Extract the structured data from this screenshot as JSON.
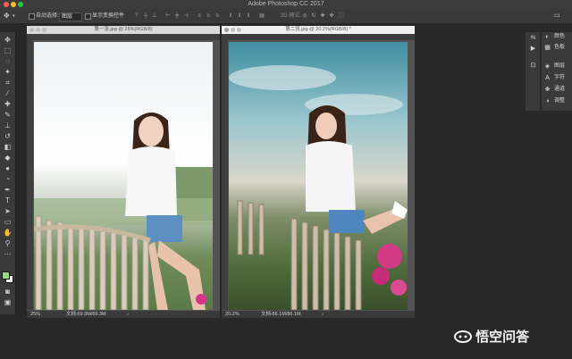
{
  "window": {
    "title": "Adobe Photoshop CC 2017"
  },
  "options_bar": {
    "auto_select_label": "自动选择:",
    "auto_select_value": "图层",
    "transform_controls_label": "显示变换控件",
    "mode_3d_label": "3D 模式:"
  },
  "documents": [
    {
      "tab_title": "第一张.jpg @ 25%(RGB/8)",
      "zoom": "25%",
      "doc_info": "文档:69.3M/69.3M"
    },
    {
      "tab_title": "第二张.jpg @ 20.2%(RGB/8) *",
      "zoom": "20.2%",
      "doc_info": "文档:86.1M/86.1M"
    }
  ],
  "panels": {
    "color": "颜色",
    "swatches": "色板",
    "layers": "图层",
    "character": "字符",
    "channels": "通道",
    "adjustments": "调整"
  },
  "watermark": {
    "text": "悟空问答"
  },
  "colors": {
    "foreground": "#8fe07c",
    "background": "#ffffff",
    "traffic_close": "#ff5f57",
    "traffic_min": "#febc2e",
    "traffic_max": "#28c840"
  }
}
